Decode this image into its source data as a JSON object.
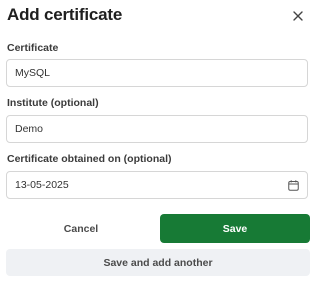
{
  "dialog": {
    "title": "Add certificate",
    "close_icon": "close-icon"
  },
  "form": {
    "certificate_label": "Certificate",
    "certificate_value": "MySQL",
    "institute_label": "Institute (optional)",
    "institute_value": "Demo",
    "date_label": "Certificate obtained on (optional)",
    "date_value": "13-05-2025",
    "date_icon": "calendar-icon"
  },
  "actions": {
    "cancel_label": "Cancel",
    "save_label": "Save",
    "save_another_label": "Save and add another"
  },
  "colors": {
    "primary": "#177a35",
    "secondary_bg": "#eff1f4",
    "border": "#d6d6d6"
  }
}
